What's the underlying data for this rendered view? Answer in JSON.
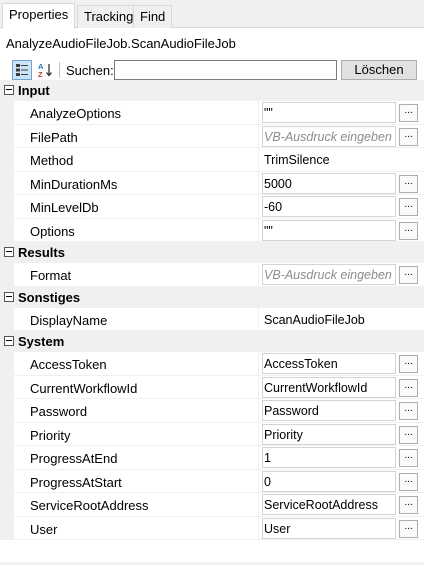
{
  "tabs": [
    {
      "label": "Properties",
      "active": true
    },
    {
      "label": "Tracking",
      "active": false
    },
    {
      "label": "Find",
      "active": false
    }
  ],
  "object_title": "AnalyzeAudioFileJob.ScanAudioFileJob",
  "toolbar": {
    "search_label": "Suchen:",
    "search_value": "",
    "clear_label": "Löschen",
    "categorized_icon": "categorized-view-icon",
    "alphabetical_icon": "sort-alphabetical-icon"
  },
  "categories": [
    {
      "name": "Input",
      "props": [
        {
          "name": "AnalyzeOptions",
          "value": "\"\"",
          "placeholder": false,
          "has_button": true
        },
        {
          "name": "FilePath",
          "value": "VB-Ausdruck eingeben",
          "placeholder": true,
          "has_button": true
        },
        {
          "name": "Method",
          "value": "TrimSilence",
          "placeholder": false,
          "has_button": false
        },
        {
          "name": "MinDurationMs",
          "value": "5000",
          "placeholder": false,
          "has_button": true
        },
        {
          "name": "MinLevelDb",
          "value": "-60",
          "placeholder": false,
          "has_button": true
        },
        {
          "name": "Options",
          "value": "\"\"",
          "placeholder": false,
          "has_button": true
        }
      ]
    },
    {
      "name": "Results",
      "props": [
        {
          "name": "Format",
          "value": "VB-Ausdruck eingeben",
          "placeholder": true,
          "has_button": true
        }
      ]
    },
    {
      "name": "Sonstiges",
      "props": [
        {
          "name": "DisplayName",
          "value": "ScanAudioFileJob",
          "placeholder": false,
          "has_button": false
        }
      ]
    },
    {
      "name": "System",
      "props": [
        {
          "name": "AccessToken",
          "value": "AccessToken",
          "placeholder": false,
          "has_button": true
        },
        {
          "name": "CurrentWorkflowId",
          "value": "CurrentWorkflowId",
          "placeholder": false,
          "has_button": true
        },
        {
          "name": "Password",
          "value": "Password",
          "placeholder": false,
          "has_button": true
        },
        {
          "name": "Priority",
          "value": "Priority",
          "placeholder": false,
          "has_button": true
        },
        {
          "name": "ProgressAtEnd",
          "value": "1",
          "placeholder": false,
          "has_button": true
        },
        {
          "name": "ProgressAtStart",
          "value": "0",
          "placeholder": false,
          "has_button": true
        },
        {
          "name": "ServiceRootAddress",
          "value": "ServiceRootAddress",
          "placeholder": false,
          "has_button": true
        },
        {
          "name": "User",
          "value": "User",
          "placeholder": false,
          "has_button": true
        }
      ]
    }
  ],
  "ellipsis_label": "...",
  "colors": {
    "accent": "#cde4f7",
    "placeholder_text": "#8c8c8c",
    "chrome": "#f0f0f0"
  }
}
